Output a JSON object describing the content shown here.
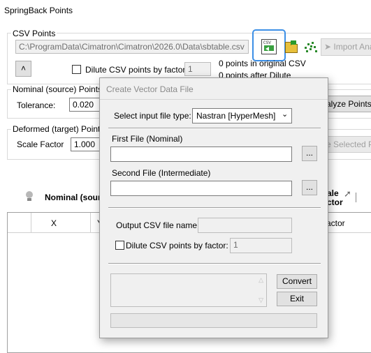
{
  "window": {
    "title": "SpringBack Points"
  },
  "csv_points": {
    "group_label": "CSV Points",
    "path": "C:\\ProgramData\\Cimatron\\Cimatron\\2026.0\\Data\\sbtable.csv",
    "import_analysis_label": "Import Ana",
    "dilute_label": "Dilute CSV points by factor:",
    "dilute_value": "1",
    "points_in_original": "0 points in original CSV",
    "points_after_dilute": "0 points after Dilute"
  },
  "nominal": {
    "group_label": "Nominal (source) Points",
    "tolerance_label": "Tolerance:",
    "tolerance_value": "0.020",
    "analyze_label": "alyze Points"
  },
  "deformed": {
    "group_label": "Deformed (target) Points",
    "scale_label": "Scale Factor",
    "scale_value": "1.000",
    "selected_label": "e Selected P"
  },
  "table": {
    "nominal_header": "Nominal (sour",
    "scale_header_1": "ale",
    "scale_header_2": "ctor",
    "col_x": "X",
    "col_y": "Y",
    "col_factor": "actor"
  },
  "dialog": {
    "title": "Create Vector Data File",
    "input_type_label": "Select input file type:",
    "input_type_value": "Nastran [HyperMesh]",
    "first_file_label": "First File (Nominal)",
    "first_file_value": "",
    "browse_label": "...",
    "second_file_label": "Second File (Intermediate)",
    "second_file_value": "",
    "output_label": "Output CSV file name:",
    "output_value": "",
    "dilute_label": "Dilute CSV points by factor:",
    "dilute_value": "1",
    "convert_label": "Convert",
    "exit_label": "Exit"
  },
  "colors": {
    "focus": "#3c8fe6",
    "window_bg": "#ffffff",
    "dialog_bg": "#f0f0f0"
  }
}
